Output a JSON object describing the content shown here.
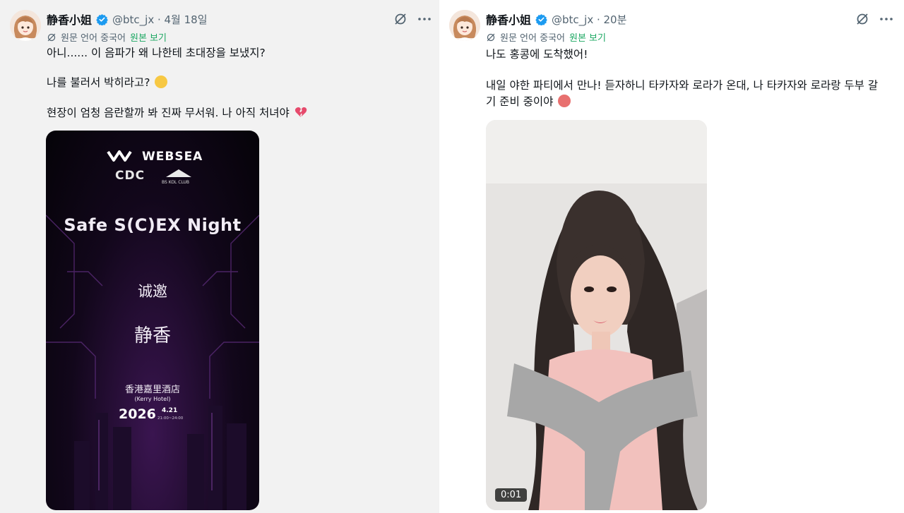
{
  "left_post": {
    "author_name": "静香小姐",
    "handle_time": "@btc_jx · 4월 18일",
    "translate_source": "원문 언어 중국어",
    "translate_link": "원본 보기",
    "line1": "아니...... 이 음파가 왜 나한테 초대장을 보냈지?",
    "line2": "나를 불러서 박히라고?",
    "line3": "현장이 엄청 음란할까 봐 진짜 무서워. 나 아직 처녀야",
    "emoji2": "sweat-smile-emoji",
    "emoji3": "broken-heart-emoji",
    "invite": {
      "brand": "WEBSEA",
      "logo2": "CDC",
      "logo3": "BS KOL CLUB",
      "title": "Safe S(C)EX Night",
      "invited": "诚邀",
      "guest": "静香",
      "venue_cn": "香港嘉里酒店",
      "venue_en": "(Kerry Hotel)",
      "year": "2026",
      "date": "4.21",
      "time": "21:00~24:00"
    }
  },
  "right_post": {
    "author_name": "静香小姐",
    "handle_time": "@btc_jx · 20분",
    "translate_source": "원문 언어 중국어",
    "translate_link": "원본 보기",
    "line1": "나도 홍콩에 도착했어!",
    "line2a": "내일 야한 파티에서 만나! 듣자하니 타카자와 로라가 온대, 나 타카자와 로라랑 두부 갈",
    "line2b": "기 준비 중이야",
    "emoji": "drooling-face-emoji",
    "video_time": "0:01"
  },
  "colors": {
    "verified": "#1d9bf0",
    "link_green": "#1da863",
    "muted": "#536471",
    "left_bg": "#f2f2f2"
  }
}
